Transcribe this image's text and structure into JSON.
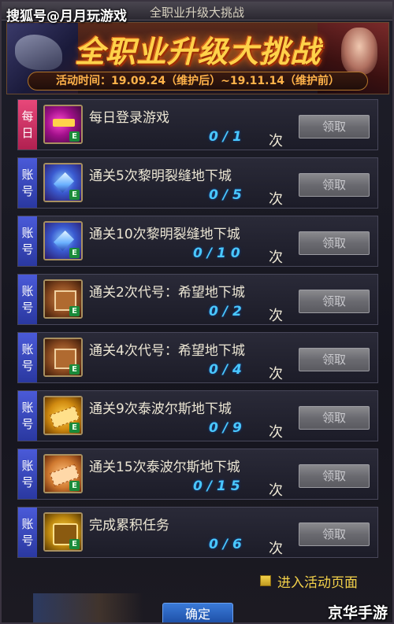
{
  "watermark_top": "搜狐号@月月玩游戏",
  "window": {
    "title": "全职业升级大挑战"
  },
  "banner": {
    "title": "全职业升级大挑战",
    "time": "活动时间：19.09.24（维护后）~19.11.14（维护前）"
  },
  "tasks": [
    {
      "tag": [
        "每",
        "日"
      ],
      "tag_kind": "daily",
      "icon": "login-reward-icon",
      "label": "每日登录游戏",
      "progress": "0/1",
      "unit": "次",
      "button": "领取"
    },
    {
      "tag": [
        "账",
        "号"
      ],
      "tag_kind": "account",
      "icon": "blue-crystal-icon",
      "label": "通关5次黎明裂缝地下城",
      "progress": "0/5",
      "unit": "次",
      "button": "领取"
    },
    {
      "tag": [
        "账",
        "号"
      ],
      "tag_kind": "account",
      "icon": "blue-crystal-icon",
      "label": "通关10次黎明裂缝地下城",
      "progress": "0/10",
      "unit": "次",
      "button": "领取"
    },
    {
      "tag": [
        "账",
        "号"
      ],
      "tag_kind": "account",
      "icon": "supply-box-icon",
      "label": "通关2次代号：希望地下城",
      "progress": "0/2",
      "unit": "次",
      "button": "领取"
    },
    {
      "tag": [
        "账",
        "号"
      ],
      "tag_kind": "account",
      "icon": "supply-box-icon",
      "label": "通关4次代号：希望地下城",
      "progress": "0/4",
      "unit": "次",
      "button": "领取"
    },
    {
      "tag": [
        "账",
        "号"
      ],
      "tag_kind": "account",
      "icon": "gold-ticket-icon",
      "label": "通关9次泰波尔斯地下城",
      "progress": "0/9",
      "unit": "次",
      "button": "领取"
    },
    {
      "tag": [
        "账",
        "号"
      ],
      "tag_kind": "account",
      "icon": "orange-ticket-icon",
      "label": "通关15次泰波尔斯地下城",
      "progress": "0/15",
      "unit": "次",
      "button": "领取"
    },
    {
      "tag": [
        "账",
        "号"
      ],
      "tag_kind": "account",
      "icon": "treasure-chest-icon",
      "label": "完成累积任务",
      "progress": "0/6",
      "unit": "次",
      "button": "领取"
    }
  ],
  "enter_page_label": "进入活动页面",
  "confirm_label": "确定",
  "watermark_bottom": "京华手游",
  "colors": {
    "progress": "#4ac8ff",
    "daily_tag": "#e8487a",
    "account_tag": "#3a48c0",
    "link": "#f4d24a"
  }
}
